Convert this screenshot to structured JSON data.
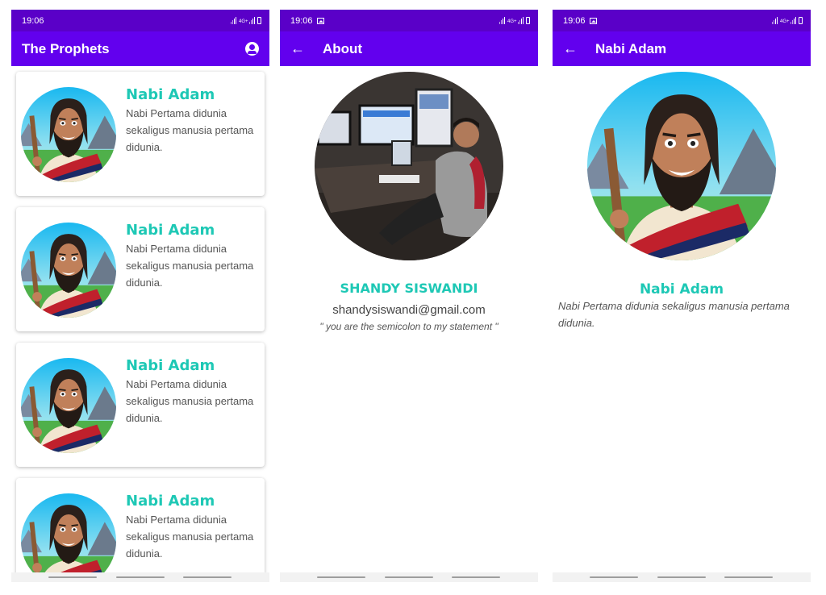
{
  "status": {
    "time": "19:06",
    "network": "4G+"
  },
  "colors": {
    "primary": "#6200ee",
    "status_bar": "#5a00c8",
    "accent": "#1ec8b5"
  },
  "list_screen": {
    "title": "The Prophets",
    "action_icon": "account-circle-icon",
    "items": [
      {
        "name": "Nabi Adam",
        "description": "Nabi Pertama didunia sekaligus manusia pertama didunia."
      },
      {
        "name": "Nabi Adam",
        "description": "Nabi Pertama didunia sekaligus manusia pertama didunia."
      },
      {
        "name": "Nabi Adam",
        "description": "Nabi Pertama didunia sekaligus manusia pertama didunia."
      },
      {
        "name": "Nabi Adam",
        "description": "Nabi Pertama didunia sekaligus manusia pertama didunia."
      }
    ]
  },
  "about_screen": {
    "title": "About",
    "back_icon": "arrow-back-icon",
    "name": "SHANDY SISWANDI",
    "email": "shandysiswandi@gmail.com",
    "quote": "\" you are the semicolon to my statement \""
  },
  "detail_screen": {
    "title": "Nabi Adam",
    "back_icon": "arrow-back-icon",
    "name": "Nabi Adam",
    "description": "Nabi Pertama didunia sekaligus manusia pertama didunia."
  }
}
